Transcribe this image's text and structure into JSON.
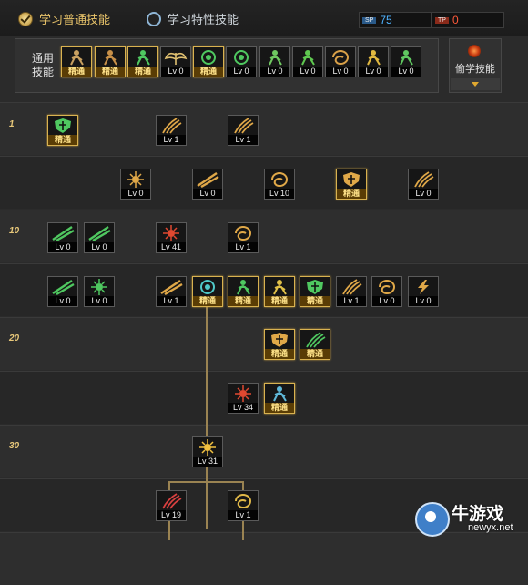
{
  "tabs": {
    "general": "学习普通技能",
    "special": "学习特性技能"
  },
  "sp": {
    "sp_tag": "SP",
    "sp_value": "75",
    "tp_tag": "TP",
    "tp_value": "0",
    "sp_color": "#4fb3ff",
    "tp_color": "#ff5a3a"
  },
  "general": {
    "label": "通用技能",
    "skills": [
      {
        "id": "g1",
        "icon": "ankle-kick-icon",
        "label": "精通",
        "mastered": true,
        "color": "#c8a060"
      },
      {
        "id": "g2",
        "icon": "leap-icon",
        "label": "精通",
        "mastered": true,
        "color": "#c89048"
      },
      {
        "id": "g3",
        "icon": "dash-icon",
        "label": "精通",
        "mastered": true,
        "color": "#4fc860"
      },
      {
        "id": "g4",
        "icon": "wing-icon",
        "label": "Lv 0",
        "mastered": false,
        "color": "#e0c070"
      },
      {
        "id": "g5",
        "icon": "crosshair-icon",
        "label": "精通",
        "mastered": true,
        "color": "#4fc860"
      },
      {
        "id": "g6",
        "icon": "crosshair-star-icon",
        "label": "Lv 0",
        "mastered": false,
        "color": "#4fc860"
      },
      {
        "id": "g7",
        "icon": "recover-icon",
        "label": "Lv 0",
        "mastered": false,
        "color": "#6fc860"
      },
      {
        "id": "g8",
        "icon": "figure-glow-icon",
        "label": "Lv 0",
        "mastered": false,
        "color": "#5fc850"
      },
      {
        "id": "g9",
        "icon": "spiral-icon",
        "label": "Lv 0",
        "mastered": false,
        "color": "#d8a048"
      },
      {
        "id": "g10",
        "icon": "strongman-icon",
        "label": "Lv 0",
        "mastered": false,
        "color": "#e0b840"
      },
      {
        "id": "g11",
        "icon": "sprint-icon",
        "label": "Lv 0",
        "mastered": false,
        "color": "#5fc860"
      }
    ]
  },
  "steal": {
    "label": "偷学技能"
  },
  "tree": {
    "levels": [
      "1",
      "10",
      "20",
      "30"
    ],
    "skills": [
      {
        "id": "t1",
        "icon": "base-shield-icon",
        "label": "精通",
        "mastered": true,
        "color": "#4fc860"
      },
      {
        "id": "t2",
        "icon": "claw-slash-icon",
        "label": "Lv 1",
        "mastered": false,
        "color": "#e0a848"
      },
      {
        "id": "t3",
        "icon": "arc-slash-icon",
        "label": "Lv 1",
        "mastered": false,
        "color": "#e0a848"
      },
      {
        "id": "t4",
        "icon": "burst-arrows-icon",
        "label": "Lv 0",
        "mastered": false,
        "color": "#e0a848"
      },
      {
        "id": "t5",
        "icon": "thrust-icon",
        "label": "Lv 0",
        "mastered": false,
        "color": "#e0a848"
      },
      {
        "id": "t6",
        "icon": "whirl-slash-icon",
        "label": "Lv 10",
        "mastered": false,
        "color": "#e0a848"
      },
      {
        "id": "t7",
        "icon": "shield-emblem-icon",
        "label": "精通",
        "mastered": true,
        "color": "#e0a848"
      },
      {
        "id": "t8",
        "icon": "triple-blade-icon",
        "label": "Lv 0",
        "mastered": false,
        "color": "#e0a848"
      },
      {
        "id": "t9",
        "icon": "green-lance-icon",
        "label": "Lv 0",
        "mastered": false,
        "color": "#4fc860"
      },
      {
        "id": "t10",
        "icon": "green-blade-icon",
        "label": "Lv 0",
        "mastered": false,
        "color": "#4fc860"
      },
      {
        "id": "t11",
        "icon": "flame-strike-icon",
        "label": "Lv 41",
        "mastered": false,
        "color": "#e04830"
      },
      {
        "id": "t12",
        "icon": "vortex-icon",
        "label": "Lv 1",
        "mastered": false,
        "color": "#e0a848"
      },
      {
        "id": "t13",
        "icon": "green-slab-icon",
        "label": "Lv 0",
        "mastered": false,
        "color": "#4fc860"
      },
      {
        "id": "t14",
        "icon": "green-spark-icon",
        "label": "Lv 0",
        "mastered": false,
        "color": "#4fc860"
      },
      {
        "id": "t15",
        "icon": "cross-slash-icon",
        "label": "Lv 1",
        "mastered": false,
        "color": "#e0a848"
      },
      {
        "id": "t16",
        "icon": "gear-aura-icon",
        "label": "精通",
        "mastered": true,
        "color": "#4fc8c8"
      },
      {
        "id": "t17",
        "icon": "green-rune-icon",
        "label": "精通",
        "mastered": true,
        "color": "#4fc860"
      },
      {
        "id": "t18",
        "icon": "twin-fighters-icon",
        "label": "精通",
        "mastered": true,
        "color": "#e0c048"
      },
      {
        "id": "t19",
        "icon": "holy-cross-icon",
        "label": "精通",
        "mastered": true,
        "color": "#4fc860"
      },
      {
        "id": "t20",
        "icon": "curve-slash-icon",
        "label": "Lv 1",
        "mastered": false,
        "color": "#e0a848"
      },
      {
        "id": "t21",
        "icon": "crescent-icon",
        "label": "Lv 0",
        "mastered": false,
        "color": "#e0a848"
      },
      {
        "id": "t22",
        "icon": "lightning-icon",
        "label": "Lv 0",
        "mastered": false,
        "color": "#e0a848"
      },
      {
        "id": "t23",
        "icon": "heart-shield-icon",
        "label": "精通",
        "mastered": true,
        "color": "#e0a848"
      },
      {
        "id": "t24",
        "icon": "leaf-storm-icon",
        "label": "精通",
        "mastered": true,
        "color": "#4fc860"
      },
      {
        "id": "t25",
        "icon": "blood-burst-icon",
        "label": "Lv 34",
        "mastered": false,
        "color": "#e04830"
      },
      {
        "id": "t26",
        "icon": "frost-figure-icon",
        "label": "精通",
        "mastered": true,
        "color": "#5fb8d8"
      },
      {
        "id": "t27",
        "icon": "explosion-icon",
        "label": "Lv 31",
        "mastered": false,
        "color": "#f0c040"
      },
      {
        "id": "t28",
        "icon": "demon-claw-icon",
        "label": "Lv 19",
        "mastered": false,
        "color": "#d84040"
      },
      {
        "id": "t29",
        "icon": "golden-wave-icon",
        "label": "Lv 1",
        "mastered": false,
        "color": "#e0b848"
      }
    ]
  },
  "watermark": {
    "name": "牛游戏",
    "url": "newyx.net"
  }
}
